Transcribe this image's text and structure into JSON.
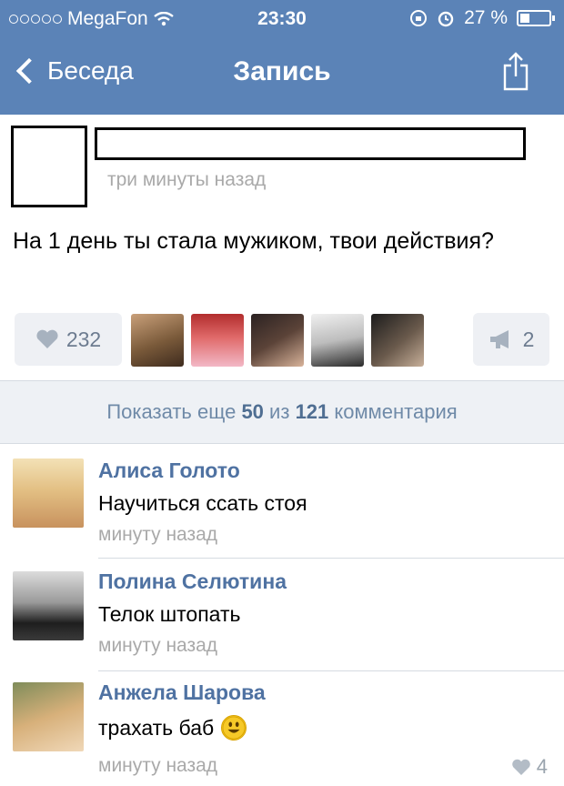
{
  "status_bar": {
    "carrier": "MegaFon",
    "time": "23:30",
    "battery": "27 %"
  },
  "nav": {
    "back_label": "Беседа",
    "title": "Запись"
  },
  "post": {
    "time": "три минуты назад",
    "text": "На 1 день ты стала мужиком, твои действия?",
    "likes_count": "232",
    "reposts_count": "2"
  },
  "show_more": {
    "prefix": "Показать еще",
    "shown": "50",
    "middle": "из",
    "total": "121",
    "suffix": "комментария"
  },
  "comments": [
    {
      "name": "Алиса Голото",
      "text": "Научиться ссать стоя",
      "time": "минуту назад"
    },
    {
      "name": "Полина Селютина",
      "text": "Телок штопать",
      "time": "минуту назад"
    },
    {
      "name": "Анжела Шарова",
      "text": "трахать баб",
      "time": "минуту назад",
      "likes": "4"
    }
  ],
  "colors": {
    "header_bg": "#5b83b7",
    "link": "#4f72a2",
    "muted": "#a9a9a9"
  }
}
